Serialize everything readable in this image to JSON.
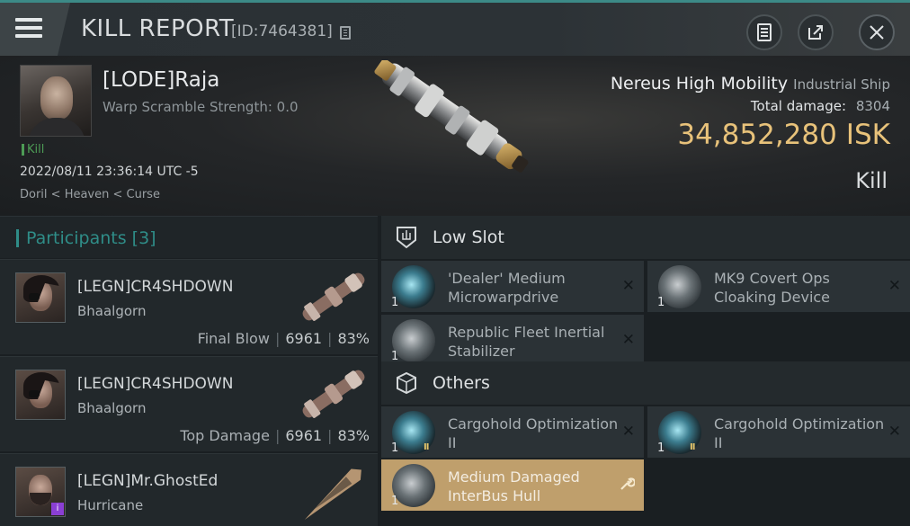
{
  "header": {
    "title": "KILL REPORT",
    "report_id": "[ID:7464381]",
    "icons": [
      "menu-icon",
      "copy-icon",
      "report-icon",
      "share-icon",
      "close-icon"
    ]
  },
  "victim": {
    "name": "[LODE]Raja",
    "warp_scramble": "Warp Scramble Strength: 0.0",
    "kill_tag": "Kill",
    "time": "2022/08/11 23:36:14 UTC -5",
    "location": "Doril < Heaven < Curse",
    "ship_name": "Nereus High Mobility",
    "ship_class": "Industrial Ship",
    "total_damage_label": "Total damage:",
    "total_damage": "8304",
    "isk_value": "34,852,280",
    "isk_unit": "ISK",
    "result": "Kill"
  },
  "participants": {
    "title": "Participants",
    "count": "[3]",
    "rows": [
      {
        "name": "[LEGN]CR4SHDOWN",
        "ship": "Bhaalgorn",
        "label": "Final Blow",
        "damage": "6961",
        "percent": "83%"
      },
      {
        "name": "[LEGN]CR4SHDOWN",
        "ship": "Bhaalgorn",
        "label": "Top Damage",
        "damage": "6961",
        "percent": "83%"
      },
      {
        "name": "[LEGN]Mr.GhostEd",
        "ship": "Hurricane",
        "badge": "i"
      }
    ]
  },
  "fitting": {
    "low_slot_title": "Low Slot",
    "others_title": "Others",
    "low_slot": [
      {
        "name": "'Dealer' Medium Microwarpdrive",
        "qty": "1"
      },
      {
        "name": "MK9 Covert Ops Cloaking Device",
        "qty": "1"
      },
      {
        "name": "Republic Fleet Inertial Stabilizer",
        "qty": "1"
      }
    ],
    "others": [
      {
        "name": "Cargohold Optimization II",
        "qty": "1",
        "tier": "II"
      },
      {
        "name": "Cargohold Optimization II",
        "qty": "1",
        "tier": "II"
      },
      {
        "name": "Medium Damaged InterBus Hull",
        "qty": "1"
      }
    ],
    "remove_glyph": "✕",
    "wrench_glyph": "🔧"
  },
  "colors": {
    "accent_teal": "#2f8d88",
    "isk_gold": "#e8c27a",
    "kill_green": "#4d9c55",
    "active_slot": "#bf9f6c"
  }
}
